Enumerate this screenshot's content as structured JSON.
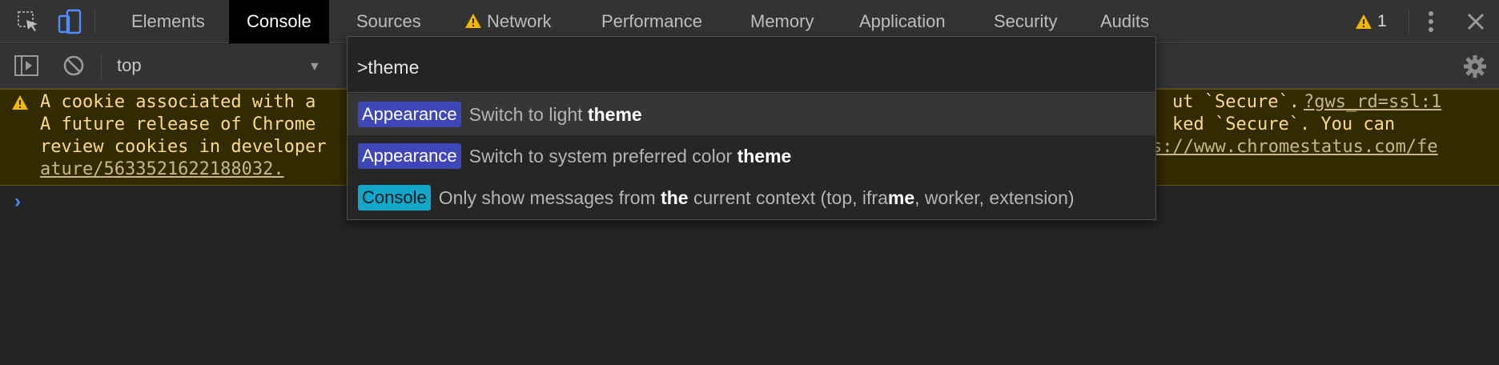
{
  "tabs": [
    {
      "label": "Elements"
    },
    {
      "label": "Console"
    },
    {
      "label": "Sources"
    },
    {
      "label": "Network"
    },
    {
      "label": "Performance"
    },
    {
      "label": "Memory"
    },
    {
      "label": "Application"
    },
    {
      "label": "Security"
    },
    {
      "label": "Audits"
    }
  ],
  "issues_count": "1",
  "toolbar": {
    "context": "top"
  },
  "warning": {
    "lines": [
      "A cookie associated with a",
      "A future release of Chrome",
      "review cookies in developer",
      "ature/5633521622188032."
    ],
    "right_lines": [
      "ut `Secure`. ",
      "ked `Secure`. You can",
      "s://www.chromestatus.com/fe"
    ],
    "source_link": "?gws_rd=ssl:1"
  },
  "palette": {
    "query": ">theme",
    "items": [
      {
        "category": "Appearance",
        "prefix": "Switch to light ",
        "match": "theme",
        "suffix": ""
      },
      {
        "category": "Appearance",
        "prefix": "Switch to system preferred color ",
        "match": "theme",
        "suffix": ""
      },
      {
        "category": "Console",
        "parts": [
          "Only show messages from ",
          "the",
          " current context (top, ifra",
          "me",
          ", worker, extension)"
        ]
      }
    ]
  },
  "colors": {
    "appearance_badge": "#3f46b8",
    "console_badge": "#12a6c8",
    "warning_bg": "#332b00",
    "warning_text": "#fdd98a"
  }
}
